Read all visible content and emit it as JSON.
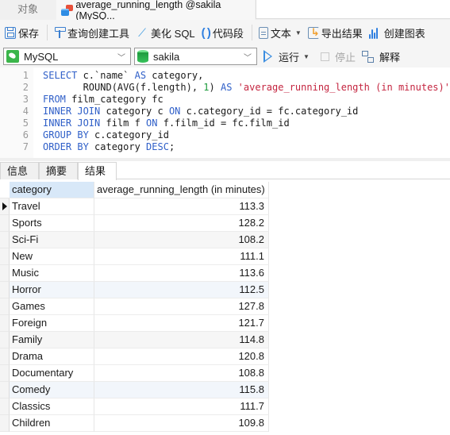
{
  "tabs": {
    "objects_label": "对象",
    "query_tab_title": "average_running_length @sakila (MySQ..."
  },
  "toolbar": {
    "save": "保存",
    "query_builder": "查询创建工具",
    "beautify_sql": "美化 SQL",
    "code_snippet": "代码段",
    "text": "文本",
    "export_results": "导出结果",
    "create_chart": "创建图表"
  },
  "connection": {
    "connection_value": "MySQL",
    "database_value": "sakila",
    "run": "运行",
    "stop": "停止",
    "explain": "解释"
  },
  "editor": {
    "line_numbers": [
      "1",
      "2",
      "3",
      "4",
      "5",
      "6",
      "7"
    ],
    "lines": [
      [
        {
          "t": "SELECT",
          "k": "kw"
        },
        {
          "t": " c.`name` "
        },
        {
          "t": "AS",
          "k": "kw"
        },
        {
          "t": " category,"
        }
      ],
      [
        {
          "t": "       ROUND(AVG(f.length), "
        },
        {
          "t": "1",
          "k": "num"
        },
        {
          "t": ") "
        },
        {
          "t": "AS",
          "k": "kw"
        },
        {
          "t": " "
        },
        {
          "t": "'average_running_length (in minutes)'",
          "k": "str"
        }
      ],
      [
        {
          "t": "FROM",
          "k": "kw"
        },
        {
          "t": " film_category fc"
        }
      ],
      [
        {
          "t": "INNER JOIN",
          "k": "kw"
        },
        {
          "t": " category c "
        },
        {
          "t": "ON",
          "k": "kw"
        },
        {
          "t": " c.category_id = fc.category_id"
        }
      ],
      [
        {
          "t": "INNER JOIN",
          "k": "kw"
        },
        {
          "t": " film f "
        },
        {
          "t": "ON",
          "k": "kw"
        },
        {
          "t": " f.film_id = fc.film_id"
        }
      ],
      [
        {
          "t": "GROUP BY",
          "k": "kw"
        },
        {
          "t": " c.category_id"
        }
      ],
      [
        {
          "t": "ORDER BY",
          "k": "kw"
        },
        {
          "t": " category "
        },
        {
          "t": "DESC",
          "k": "kw"
        },
        {
          "t": ";"
        }
      ]
    ]
  },
  "result_tabs": {
    "info": "信息",
    "summary": "摘要",
    "result1": "结果 1"
  },
  "grid": {
    "columns": [
      "category",
      "average_running_length (in minutes)"
    ],
    "rows": [
      [
        "Travel",
        "113.3"
      ],
      [
        "Sports",
        "128.2"
      ],
      [
        "Sci-Fi",
        "108.2"
      ],
      [
        "New",
        "111.1"
      ],
      [
        "Music",
        "113.6"
      ],
      [
        "Horror",
        "112.5"
      ],
      [
        "Games",
        "127.8"
      ],
      [
        "Foreign",
        "121.7"
      ],
      [
        "Family",
        "114.8"
      ],
      [
        "Drama",
        "120.8"
      ],
      [
        "Documentary",
        "108.8"
      ],
      [
        "Comedy",
        "115.8"
      ],
      [
        "Classics",
        "111.7"
      ],
      [
        "Children",
        "109.8"
      ]
    ],
    "current_row": 0
  }
}
